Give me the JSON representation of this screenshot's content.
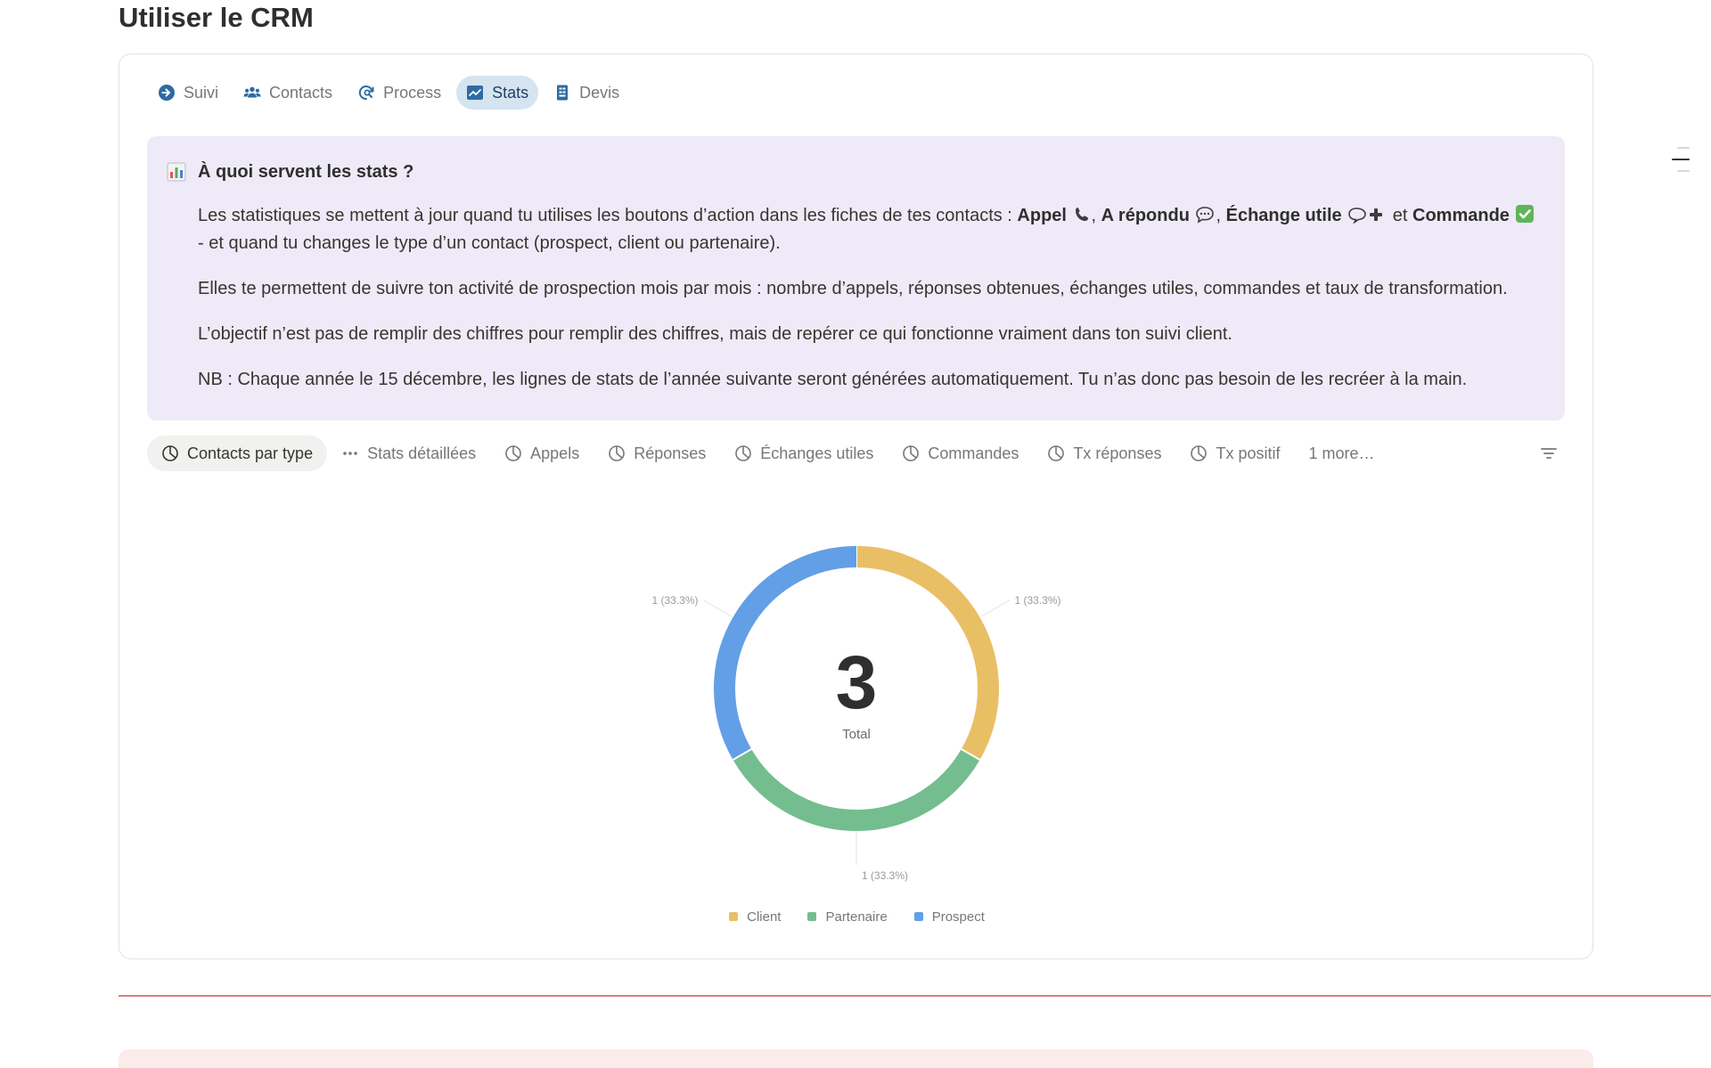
{
  "page": {
    "title": "Utiliser le CRM"
  },
  "tabs": [
    {
      "label": "Suivi",
      "icon": "arrow-circle-right-icon",
      "active": false
    },
    {
      "label": "Contacts",
      "icon": "people-icon",
      "active": false
    },
    {
      "label": "Process",
      "icon": "cycle-search-icon",
      "active": false
    },
    {
      "label": "Stats",
      "icon": "chart-line-icon",
      "active": true
    },
    {
      "label": "Devis",
      "icon": "receipt-icon",
      "active": false
    }
  ],
  "callout": {
    "icon": "bar-chart-emoji",
    "title": "À quoi servent les stats ?",
    "p1": {
      "before": "Les statistiques se mettent à jour quand tu utilises les boutons d’action dans les fiches de tes contacts : ",
      "b1": "Appel",
      "sep1": ", ",
      "b2": "A répondu",
      "sep2": ", ",
      "b3": "Échange utile",
      "sep3": " et ",
      "b4": "Commande",
      "after": " - et quand tu changes le type d’un contact (prospect, client ou partenaire)."
    },
    "p2": "Elles te permettent de suivre ton activité de prospection mois par mois : nombre d’appels, réponses obtenues, échanges utiles, commandes et taux de transformation.",
    "p3": "L’objectif n’est pas de remplir des chiffres pour remplir des chiffres, mais de repérer ce qui fonctionne vraiment dans ton suivi client.",
    "p4": "NB : Chaque année le 15 décembre, les lignes de stats de l’année suivante seront générées automatiquement. Tu n’as donc pas besoin de les recréer à la main."
  },
  "views": [
    {
      "label": "Contacts par type",
      "icon": "pie-chart-icon",
      "active": true
    },
    {
      "label": "Stats détaillées",
      "icon": "ellipsis-icon",
      "active": false
    },
    {
      "label": "Appels",
      "icon": "pie-chart-icon",
      "active": false
    },
    {
      "label": "Réponses",
      "icon": "pie-chart-icon",
      "active": false
    },
    {
      "label": "Échanges utiles",
      "icon": "pie-chart-icon",
      "active": false
    },
    {
      "label": "Commandes",
      "icon": "pie-chart-icon",
      "active": false
    },
    {
      "label": "Tx réponses",
      "icon": "pie-chart-icon",
      "active": false
    },
    {
      "label": "Tx positif",
      "icon": "pie-chart-icon",
      "active": false
    }
  ],
  "more_views_label": "1 more…",
  "colors": {
    "client": "#e9bf66",
    "partenaire": "#74bd8e",
    "prospect": "#629fe6",
    "divider": "#e07b7b"
  },
  "chart_data": {
    "type": "pie",
    "variant": "donut",
    "title": "",
    "center_value": "3",
    "center_label": "Total",
    "series": [
      {
        "name": "Client",
        "value": 1,
        "label": "1 (33.3%)",
        "color": "#e9bf66"
      },
      {
        "name": "Partenaire",
        "value": 1,
        "label": "1 (33.3%)",
        "color": "#74bd8e"
      },
      {
        "name": "Prospect",
        "value": 1,
        "label": "1 (33.3%)",
        "color": "#629fe6"
      }
    ],
    "legend_position": "bottom"
  }
}
